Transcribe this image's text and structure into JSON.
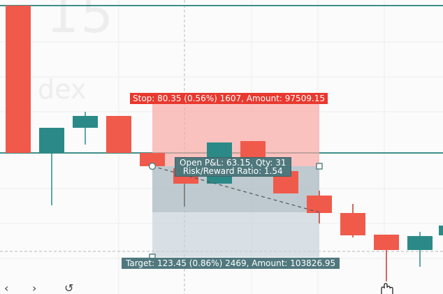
{
  "watermark": {
    "big": "15",
    "small": "dex"
  },
  "position": {
    "stop_label": "Stop: 80.35 (0.56%) 1607, Amount: 97509.15",
    "pnl_line1": "Open P&L: 63.15, Qty: 31",
    "pnl_line2": "Risk/Reward Ratio: 1.54",
    "target_label": "Target: 123.45 (0.86%) 2469, Amount: 103826.95"
  },
  "nav": {
    "back": "‹",
    "forward": "›",
    "reset": "↺"
  },
  "icons": {
    "cursor": "hand-cursor-icon"
  },
  "colors": {
    "bull": "#2b8a88",
    "bear": "#f05a4b",
    "line": "#3f8f89",
    "stop_zone": "#f9aaa5",
    "target_zone": "#c6d1d8",
    "stop_badge": "#e8392f",
    "target_badge": "#50787e"
  }
}
